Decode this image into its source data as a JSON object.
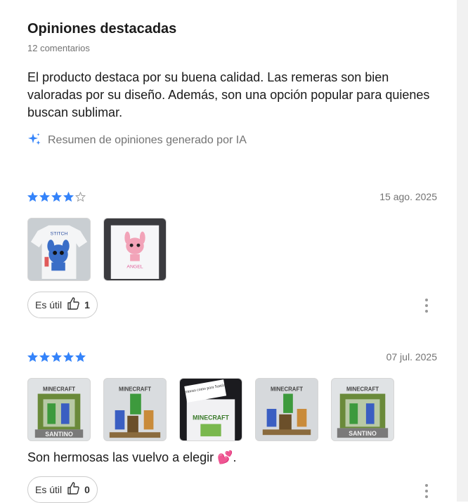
{
  "header": {
    "title": "Opiniones destacadas",
    "count_text": "12 comentarios"
  },
  "summary": {
    "text": "El producto destaca por su buena calidad. Las remeras son bien valoradas por su diseño. Además, son una opción popular para quienes buscan sublimar.",
    "ai_label": "Resumen de opiniones generado por IA",
    "ai_icon": "sparkle-icon"
  },
  "colors": {
    "accent": "#3483fa",
    "muted_text": "#737373",
    "border": "#cccccc"
  },
  "reviews": [
    {
      "rating": 4,
      "max_rating": 5,
      "date": "15 ago. 2025",
      "photo_count": 2,
      "text": "",
      "useful_label": "Es útil",
      "useful_count": "1"
    },
    {
      "rating": 5,
      "max_rating": 5,
      "date": "07 jul. 2025",
      "photo_count": 5,
      "text": "Son hermosas las vuelvo a elegir 💕.",
      "useful_label": "Es útil",
      "useful_count": "0"
    }
  ],
  "photo_captions": {
    "stitch_text": "STITCH",
    "angel_text": "ANGEL",
    "minecraft_text": "MINECRAFT",
    "santino_text": "SANTINO",
    "note_text": "Hermosa como para Santino"
  }
}
